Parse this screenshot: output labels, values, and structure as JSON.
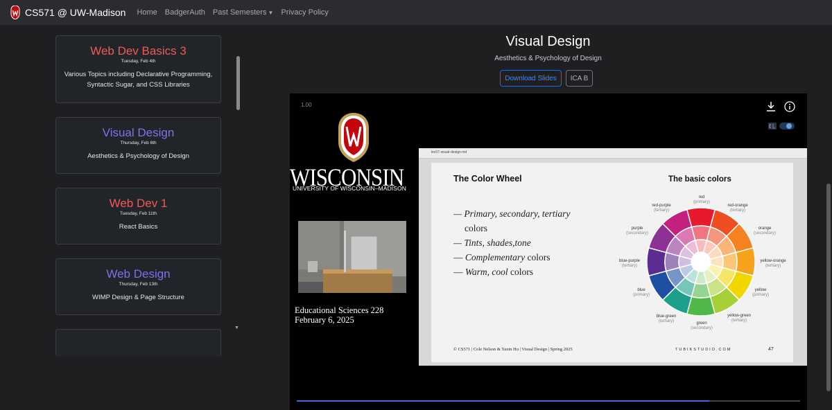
{
  "navbar": {
    "brand": "CS571 @ UW-Madison",
    "links": [
      "Home",
      "BadgerAuth",
      "Past Semesters",
      "Privacy Policy"
    ]
  },
  "sidebar": {
    "cards": [
      {
        "title": "Web Dev Basics 3",
        "date": "Tuesday, Feb 4th",
        "desc": "Various Topics including Declarative Programming, Syntactic Sugar, and CSS Libraries",
        "color": "#f05a55"
      },
      {
        "title": "Visual Design",
        "date": "Thursday, Feb 6th",
        "desc": "Aesthetics & Psychology of Design",
        "color": "#7d73e6"
      },
      {
        "title": "Web Dev 1",
        "date": "Tuesday, Feb 11th",
        "desc": "React Basics",
        "color": "#f05a55"
      },
      {
        "title": "Web Design",
        "date": "Thursday, Feb 13th",
        "desc": "WIMP Design & Page Structure",
        "color": "#7d73e6"
      }
    ]
  },
  "main": {
    "title": "Visual Design",
    "subtitle": "Aesthetics & Psychology of Design",
    "download_label": "Download Slides",
    "ica_label": "ICA B"
  },
  "video": {
    "speed": "1.00",
    "logo_word": "WISCONSIN",
    "logo_sub": "UNIVERSITY OF WISCONSIN–MADISON",
    "location": "Educational Sciences 228",
    "date": "February 6, 2025",
    "progress": 0.82,
    "slide_file": "lec07-visual-design.md",
    "slide": {
      "title": "The Color Wheel",
      "bullet1": "— Primary, secondary, tertiary",
      "bullet1b": "colors",
      "bullet2": "— Tints, shades,tone",
      "bullet3_em": "Complementary",
      "bullet3_rest": " colors",
      "bullet4_em": "Warm, cool",
      "bullet4_rest": " colors",
      "wheel_title": "The basic colors",
      "footer": "© CS571 | Cole Nelson & Yaxin Hu | Visual Design | Spring 2025",
      "brand": "TUBIKSTUDIO.COM",
      "page": "47",
      "labels": [
        {
          "name": "red",
          "type": "(primary)"
        },
        {
          "name": "red-orange",
          "type": "(tertiary)"
        },
        {
          "name": "orange",
          "type": "(secondary)"
        },
        {
          "name": "yellow-orange",
          "type": "(tertiary)"
        },
        {
          "name": "yellow",
          "type": "(primary)"
        },
        {
          "name": "yellow-green",
          "type": "(tertiary)"
        },
        {
          "name": "green",
          "type": "(secondary)"
        },
        {
          "name": "blue-green",
          "type": "(tertiary)"
        },
        {
          "name": "blue",
          "type": "(primary)"
        },
        {
          "name": "blue-purple",
          "type": "(tertiary)"
        },
        {
          "name": "purple",
          "type": "(secondary)"
        },
        {
          "name": "red-purple",
          "type": "(tertiary)"
        }
      ],
      "wheel_colors": [
        "#e8192c",
        "#ef4e23",
        "#f5821f",
        "#f7a21b",
        "#f2d600",
        "#a6cf38",
        "#4fb848",
        "#1ca08c",
        "#1f4fa3",
        "#5b2d90",
        "#8e3195",
        "#c4207e"
      ]
    }
  }
}
